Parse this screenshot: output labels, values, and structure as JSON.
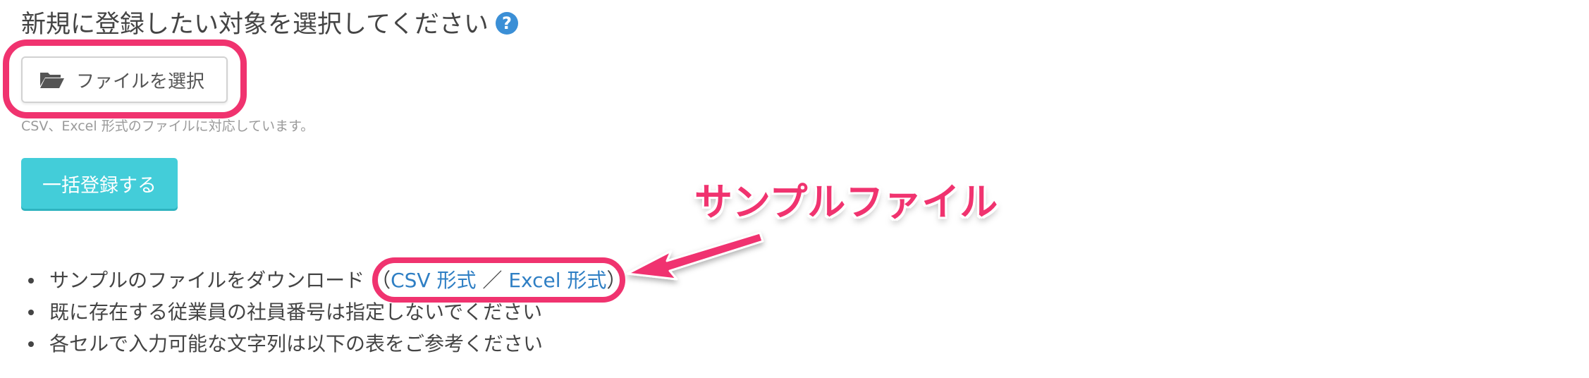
{
  "page": {
    "title": "新規に登録したい対象を選択してください",
    "help_icon_glyph": "?"
  },
  "file_picker": {
    "button_label": "ファイルを選択",
    "icon": "folder-open-icon",
    "hint": "CSV、Excel 形式のファイルに対応しています。"
  },
  "bulk_register": {
    "button_label": "一括登録する"
  },
  "annotation": {
    "label": "サンプルファイル",
    "color": "#f0336f"
  },
  "notes": {
    "item1_text": "サンプルのファイルをダウンロード",
    "paren_open": "（",
    "csv_link": "CSV 形式",
    "separator": "／",
    "excel_link": "Excel 形式",
    "paren_close": "）",
    "item2_text": "既に存在する従業員の社員番号は指定しないでください",
    "item3_text": "各セルで入力可能な文字列は以下の表をご参考ください"
  },
  "colors": {
    "accent_teal": "#43cdd9",
    "link_blue": "#2f7fc4",
    "help_blue": "#3b8fd6",
    "highlight_pink": "#f0336f"
  }
}
